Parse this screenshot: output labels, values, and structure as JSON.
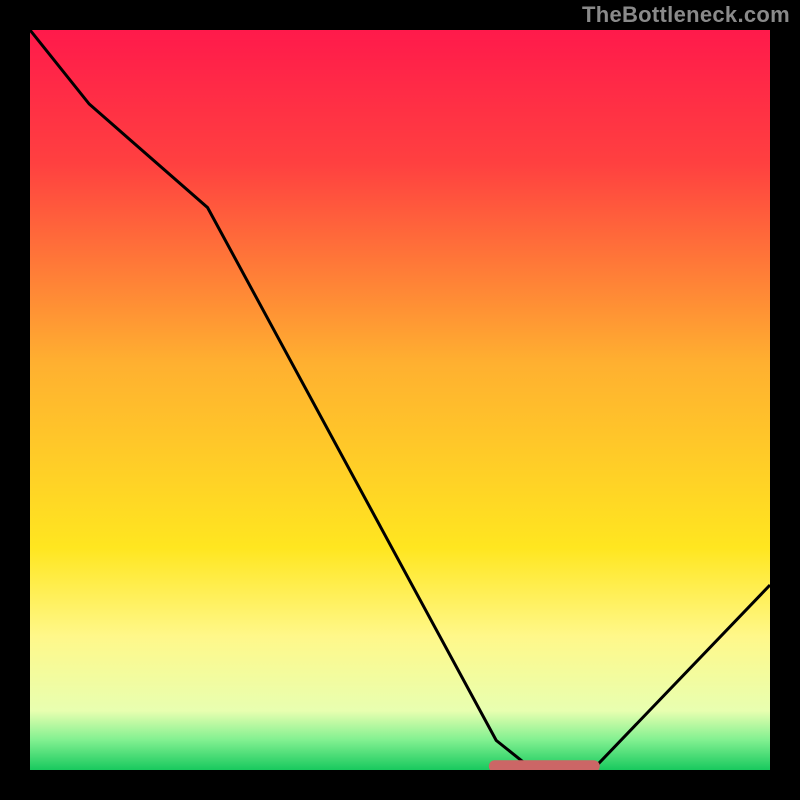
{
  "watermark": "TheBottleneck.com",
  "chart_data": {
    "type": "line",
    "x": [
      0,
      8,
      24,
      63,
      68,
      76,
      100
    ],
    "values": [
      100,
      90,
      76,
      4,
      0,
      0,
      25
    ],
    "optimal_zone": {
      "x_start": 62,
      "x_end": 77,
      "y": 0.5
    },
    "title": "",
    "xlabel": "",
    "ylabel": "",
    "xlim": [
      0,
      100
    ],
    "ylim": [
      0,
      100
    ],
    "colormap_stops": [
      {
        "pct": 0.0,
        "color": "#ff1a4b"
      },
      {
        "pct": 0.18,
        "color": "#ff4040"
      },
      {
        "pct": 0.45,
        "color": "#ffb030"
      },
      {
        "pct": 0.7,
        "color": "#ffe620"
      },
      {
        "pct": 0.82,
        "color": "#fff88a"
      },
      {
        "pct": 0.92,
        "color": "#e8ffb0"
      },
      {
        "pct": 0.96,
        "color": "#80f090"
      },
      {
        "pct": 1.0,
        "color": "#18c95e"
      }
    ],
    "curve_color": "#000000",
    "marker_color": "#cc6666"
  }
}
